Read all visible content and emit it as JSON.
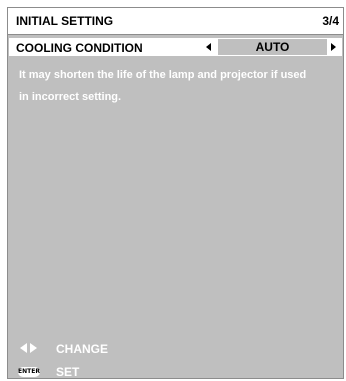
{
  "header": {
    "title": "INITIAL SETTING",
    "page": "3/4"
  },
  "setting": {
    "label": "COOLING CONDITION",
    "value": "AUTO"
  },
  "message": {
    "line1": "It may shorten the life of the lamp and projector if used",
    "line2": "in incorrect setting."
  },
  "footer": {
    "change_label": "CHANGE",
    "set_label": "SET",
    "enter_icon_text": "ENTER"
  },
  "icons": {
    "left_arrow": "left-arrow-icon",
    "right_arrow": "right-arrow-icon",
    "left_right": "left-right-arrows-icon",
    "enter": "enter-button-icon"
  },
  "colors": {
    "panel": "#bfbfbf",
    "highlight": "#ffffff",
    "text_on_panel": "#ffffff",
    "text": "#000000"
  }
}
